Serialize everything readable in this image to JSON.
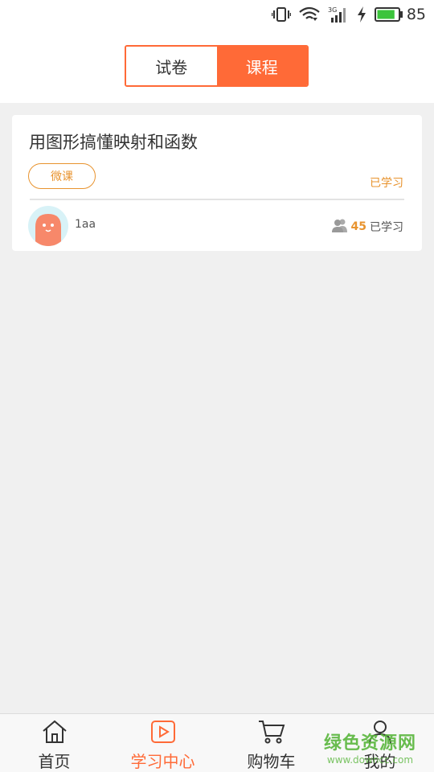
{
  "status_bar": {
    "icons": [
      "vibrate-icon",
      "wifi-icon",
      "signal-3g-icon",
      "charging-icon",
      "battery-icon"
    ],
    "network_label": "3G",
    "battery_level": "85",
    "battery_color": "#3cc43c"
  },
  "header": {
    "tabs": [
      {
        "label": "试卷",
        "selected": false
      },
      {
        "label": "课程",
        "selected": true
      }
    ],
    "accent_color": "#ff6a37"
  },
  "course_card": {
    "title": "用图形搞懂映射和函数",
    "tag": "微课",
    "status": "已学习",
    "author": "1aa",
    "learner_count": "45",
    "learner_suffix": "已学习",
    "tag_color": "#e8932e"
  },
  "tab_bar": {
    "items": [
      {
        "label": "首页",
        "icon": "home-icon",
        "active": false
      },
      {
        "label": "学习中心",
        "icon": "play-icon",
        "active": true
      },
      {
        "label": "购物车",
        "icon": "cart-icon",
        "active": false
      },
      {
        "label": "我的",
        "icon": "user-icon",
        "active": false
      }
    ]
  },
  "watermark": {
    "text": "绿色资源网",
    "url": "www.downcc.com"
  }
}
